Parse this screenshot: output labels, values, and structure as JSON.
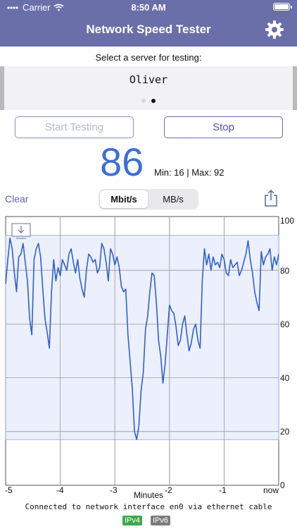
{
  "status": {
    "carrier": "Carrier",
    "time": "8:50 AM"
  },
  "nav": {
    "title": "Network Speed Tester",
    "settings_icon": "gear-icon"
  },
  "server": {
    "label": "Select a server for testing:",
    "selected": "Oliver",
    "page_count": 2,
    "current_page": 2
  },
  "buttons": {
    "start": "Start Testing",
    "stop": "Stop"
  },
  "speed": {
    "value": "86",
    "minmax": "Min: 16 | Max: 92"
  },
  "controls": {
    "clear": "Clear",
    "units": [
      "Mbit/s",
      "MB/s"
    ],
    "selected_unit": "Mbit/s",
    "share_icon": "share-icon"
  },
  "colors": {
    "nav": "#6a6ea9",
    "accent": "#3d6fd1",
    "line": "#2f5fd0",
    "band": "#e9edfb",
    "ipv4": "#3da84b",
    "ipv6": "#7b7b7b"
  },
  "chart_data": {
    "type": "line",
    "xlabel": "Minutes",
    "ylabel": "",
    "xlim": [
      -5,
      0
    ],
    "ylim": [
      0,
      100
    ],
    "x_ticks": [
      "-5",
      "-4",
      "-3",
      "-2",
      "-1",
      "now"
    ],
    "y_ticks": [
      "0",
      "20",
      "40",
      "60",
      "80",
      "100"
    ],
    "band": [
      17,
      93
    ],
    "series": [
      {
        "x": [
          -5.0,
          -4.96,
          -4.92,
          -4.88,
          -4.84,
          -4.8,
          -4.76,
          -4.72,
          -4.68,
          -4.64,
          -4.6,
          -4.56,
          -4.52,
          -4.48,
          -4.44,
          -4.4,
          -4.36,
          -4.32,
          -4.28,
          -4.24,
          -4.2,
          -4.16,
          -4.12,
          -4.08,
          -4.04,
          -4.0,
          -3.96,
          -3.92,
          -3.88,
          -3.84,
          -3.8,
          -3.76,
          -3.72,
          -3.68,
          -3.64,
          -3.6,
          -3.56,
          -3.52,
          -3.48,
          -3.44,
          -3.4,
          -3.36,
          -3.32,
          -3.28,
          -3.24,
          -3.2,
          -3.16,
          -3.12,
          -3.08,
          -3.04,
          -3.0,
          -2.96,
          -2.92,
          -2.88,
          -2.84,
          -2.8,
          -2.76,
          -2.72,
          -2.68,
          -2.64,
          -2.6,
          -2.56,
          -2.52,
          -2.48,
          -2.44,
          -2.4,
          -2.36,
          -2.32,
          -2.28,
          -2.24,
          -2.2,
          -2.16,
          -2.12,
          -2.08,
          -2.04,
          -2.0,
          -1.96,
          -1.92,
          -1.88,
          -1.84,
          -1.8,
          -1.76,
          -1.72,
          -1.68,
          -1.64,
          -1.6,
          -1.56,
          -1.52,
          -1.48,
          -1.44,
          -1.4,
          -1.36,
          -1.32,
          -1.28,
          -1.24,
          -1.2,
          -1.16,
          -1.12,
          -1.08,
          -1.04,
          -1.0,
          -0.96,
          -0.92,
          -0.88,
          -0.84,
          -0.8,
          -0.76,
          -0.72,
          -0.68,
          -0.64,
          -0.6,
          -0.56,
          -0.52,
          -0.48,
          -0.44,
          -0.4,
          -0.36,
          -0.32,
          -0.28,
          -0.24,
          -0.2,
          -0.16,
          -0.12,
          -0.08,
          -0.04,
          0.0
        ],
        "y": [
          75,
          84,
          92,
          88,
          79,
          72,
          85,
          86,
          90,
          83,
          76,
          62,
          56,
          84,
          88,
          90,
          85,
          73,
          62,
          57,
          51,
          72,
          84,
          76,
          81,
          78,
          84,
          82,
          80,
          86,
          88,
          83,
          79,
          84,
          77,
          73,
          70,
          80,
          86,
          85,
          83,
          84,
          79,
          81,
          90,
          88,
          83,
          76,
          88,
          86,
          82,
          85,
          81,
          74,
          72,
          73,
          56,
          46,
          36,
          20,
          17,
          22,
          35,
          42,
          58,
          63,
          72,
          79,
          78,
          68,
          54,
          48,
          38,
          45,
          56,
          67,
          65,
          64,
          59,
          52,
          54,
          60,
          63,
          56,
          50,
          53,
          58,
          60,
          54,
          51,
          76,
          88,
          82,
          86,
          80,
          85,
          82,
          83,
          81,
          86,
          84,
          79,
          78,
          84,
          81,
          82,
          83,
          78,
          80,
          83,
          86,
          91,
          84,
          79,
          72,
          68,
          65,
          87,
          82,
          85,
          86,
          88,
          80,
          85,
          82,
          86
        ]
      }
    ]
  },
  "footer": {
    "connection": "Connected to network interface en0 via ethernet cable",
    "ipv4": "IPv4",
    "ipv6": "IPv6"
  }
}
